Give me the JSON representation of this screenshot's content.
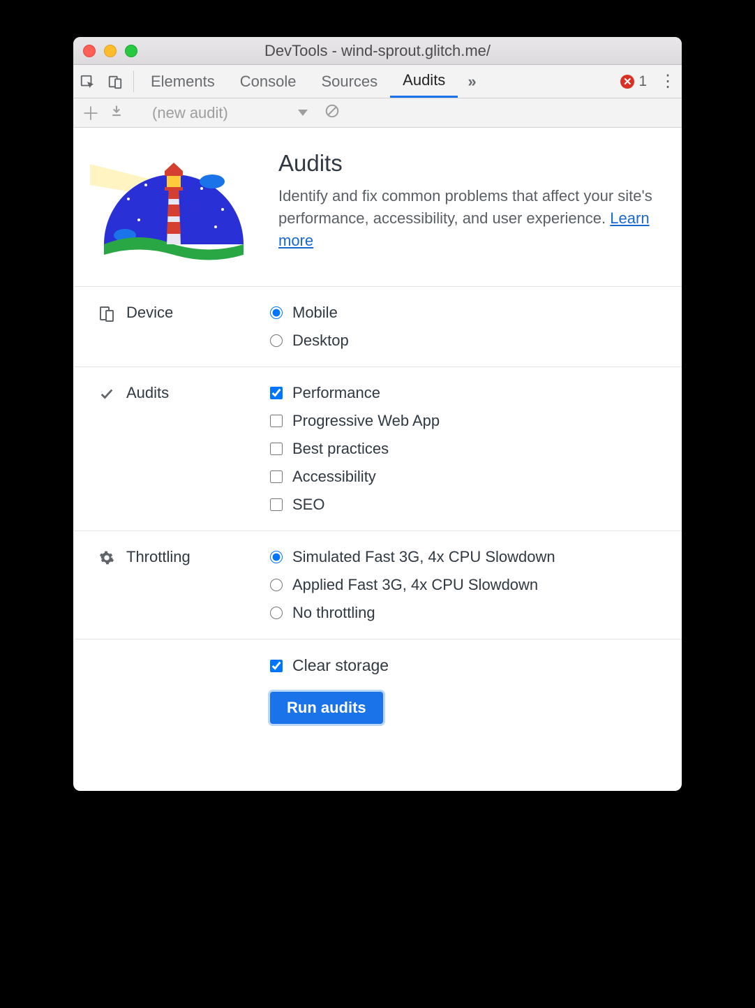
{
  "window": {
    "title": "DevTools - wind-sprout.glitch.me/"
  },
  "tabs": {
    "elements": "Elements",
    "console": "Console",
    "sources": "Sources",
    "audits": "Audits"
  },
  "errors": {
    "count": "1"
  },
  "audit_toolbar": {
    "selected": "(new audit)"
  },
  "intro": {
    "heading": "Audits",
    "body_prefix": "Identify and fix common problems that affect your site's performance, accessibility, and user experience. ",
    "learn_more": "Learn more"
  },
  "sections": {
    "device": {
      "label": "Device",
      "options": {
        "mobile": {
          "label": "Mobile",
          "checked": true
        },
        "desktop": {
          "label": "Desktop",
          "checked": false
        }
      }
    },
    "audits": {
      "label": "Audits",
      "options": {
        "performance": {
          "label": "Performance",
          "checked": true
        },
        "pwa": {
          "label": "Progressive Web App",
          "checked": false
        },
        "best": {
          "label": "Best practices",
          "checked": false
        },
        "accessibility": {
          "label": "Accessibility",
          "checked": false
        },
        "seo": {
          "label": "SEO",
          "checked": false
        }
      }
    },
    "throttling": {
      "label": "Throttling",
      "options": {
        "sim": {
          "label": "Simulated Fast 3G, 4x CPU Slowdown",
          "checked": true
        },
        "app": {
          "label": "Applied Fast 3G, 4x CPU Slowdown",
          "checked": false
        },
        "none": {
          "label": "No throttling",
          "checked": false
        }
      }
    }
  },
  "clear_storage": {
    "label": "Clear storage",
    "checked": true
  },
  "run_button": "Run audits"
}
